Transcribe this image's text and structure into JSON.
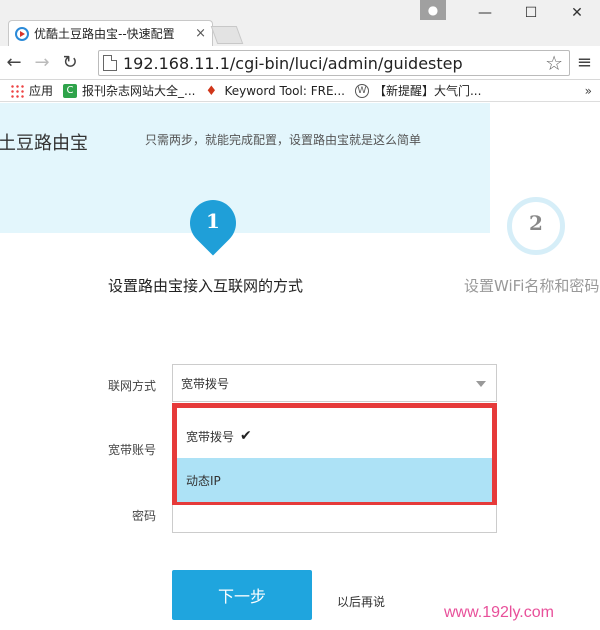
{
  "browser": {
    "tab_title": "优酷土豆路由宝--快速配置",
    "tab_close": "×",
    "user_icon": "person-icon",
    "minimize": "—",
    "maximize": "☐",
    "close": "✕",
    "url": "192.168.11.1/cgi-bin/luci/admin/guidestep"
  },
  "bookmarks": [
    {
      "label": "应用",
      "icon": "apps-icon"
    },
    {
      "label": "报刊杂志网站大全_...",
      "icon": "green-c-icon"
    },
    {
      "label": "Keyword Tool: FRE...",
      "icon": "flame-icon"
    },
    {
      "label": "【新提醒】大气门...",
      "icon": "wordpress-icon"
    }
  ],
  "bookmarks_more": "»",
  "page": {
    "brand": "土豆路由宝",
    "tagline": "只需两步，就能完成配置，设置路由宝就是这么简单",
    "step1_num": "1",
    "step1_label": "设置路由宝接入互联网的方式",
    "step2_num": "2",
    "step2_label": "设置WiFi名称和密码",
    "form": {
      "conn_label": "联网方式",
      "conn_value": "宽带拨号",
      "account_label": "宽带账号",
      "password_label": "密码",
      "options": [
        {
          "label": "宽带拨号",
          "selected": true
        },
        {
          "label": "动态IP",
          "highlighted": true
        }
      ],
      "check_mark": "✔"
    },
    "next_button": "下一步",
    "later_link": "以后再说",
    "watermark": "www.192ly.com"
  },
  "colors": {
    "accent": "#1fa5de",
    "highlight_border": "#e63a3a",
    "option_hover": "#ade2f6",
    "hero_bg": "#e3f6fc",
    "watermark": "#e8509a"
  }
}
